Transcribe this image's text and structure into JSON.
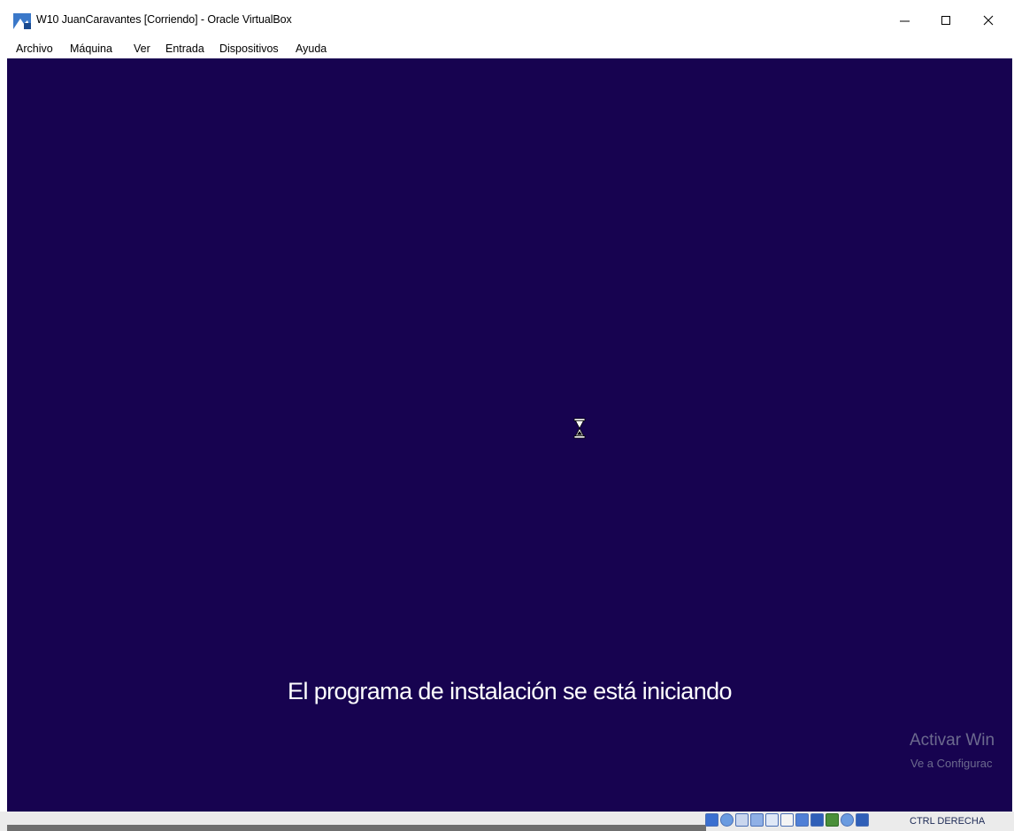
{
  "window": {
    "title": "W10 JuanCaravantes [Corriendo] - Oracle VirtualBox",
    "controls": [
      "minimize-icon",
      "maximize-icon",
      "close-icon"
    ]
  },
  "menubar": {
    "items": [
      "Archivo",
      "Máquina",
      "Ver",
      "Entrada",
      "Dispositivos",
      "Ayuda"
    ]
  },
  "vm_screen": {
    "background_color": "#170350",
    "status_text": "El programa de instalación se está iniciando",
    "cursor": "hourglass-icon",
    "watermark_title": "Activar Win",
    "watermark_subtitle": "Ve a Configurac"
  },
  "statusbar": {
    "icons": [
      "hard-disk-icon",
      "optical-drive-icon",
      "audio-icon",
      "network-icon",
      "usb-icon",
      "shared-folders-icon",
      "display-icon",
      "video-capture-icon",
      "cpu-icon",
      "mouse-integration-icon",
      "keyboard-icon"
    ],
    "host_key_label": "CTRL DERECHA"
  }
}
